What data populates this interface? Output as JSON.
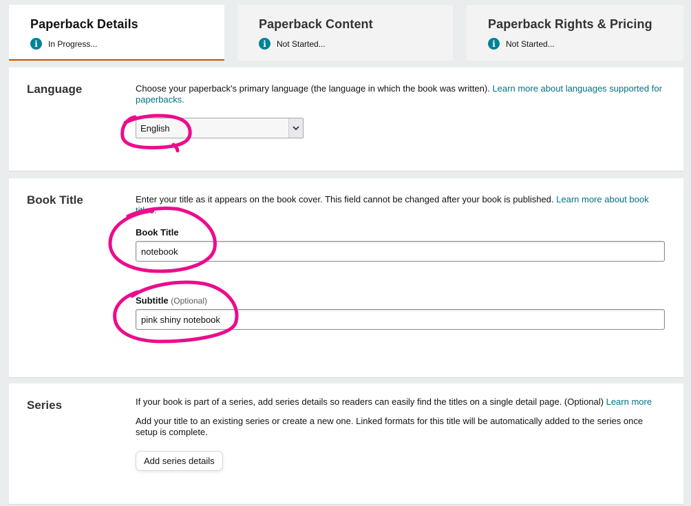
{
  "tabs": [
    {
      "title": "Paperback Details",
      "status": "In Progress..."
    },
    {
      "title": "Paperback Content",
      "status": "Not Started..."
    },
    {
      "title": "Paperback Rights & Pricing",
      "status": "Not Started..."
    }
  ],
  "info_icon_glyph": "i",
  "language": {
    "label": "Language",
    "description": "Choose your paperback's primary language (the language in which the book was written). ",
    "link": "Learn more about languages supported for paperbacks.",
    "selected": "English"
  },
  "book_title": {
    "label": "Book Title",
    "description": "Enter your title as it appears on the book cover. This field cannot be changed after your book is published. ",
    "link": "Learn more about book titles.",
    "title_field_label": "Book Title",
    "title_value": "notebook",
    "subtitle_field_label": "Subtitle",
    "subtitle_optional": "(Optional)",
    "subtitle_value": "pink shiny notebook"
  },
  "series": {
    "label": "Series",
    "description": "If your book is part of a series, add series details so readers can easily find the titles on a single detail page. (Optional) ",
    "link": "Learn more",
    "description2": "Add your title to an existing series or create a new one. Linked formats for this title will be automatically added to the series once setup is complete.",
    "button": "Add series details"
  },
  "colors": {
    "accent_tab": "#c45500",
    "info_icon": "#008296",
    "link": "#007185",
    "annotation": "#ec0c8c"
  }
}
